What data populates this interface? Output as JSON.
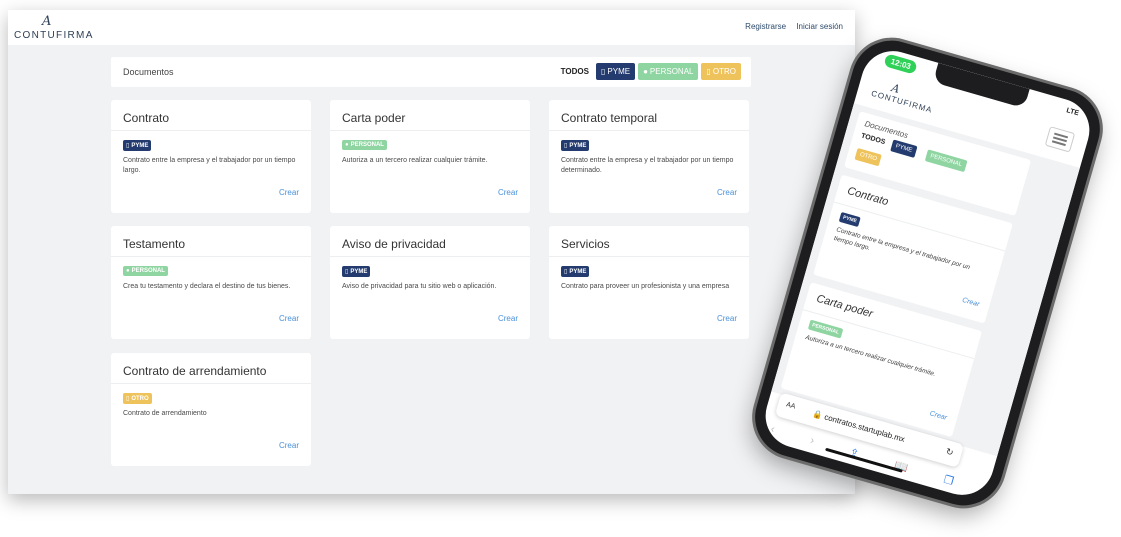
{
  "brand": {
    "mark": "A",
    "name": "CONTUFIRMA"
  },
  "nav": {
    "register": "Registrarse",
    "login": "Iniciar sesión"
  },
  "documents_bar": {
    "title": "Documentos",
    "filters": {
      "all": "TODOS",
      "pyme": "PYME",
      "personal": "PERSONAL",
      "otro": "OTRO"
    }
  },
  "cards": [
    {
      "title": "Contrato",
      "badge": "PYME",
      "description": "Contrato entre la empresa y el trabajador por un tiempo largo.",
      "action": "Crear"
    },
    {
      "title": "Carta poder",
      "badge": "PERSONAL",
      "description": "Autoriza a un tercero realizar cualquier trámite.",
      "action": "Crear"
    },
    {
      "title": "Contrato temporal",
      "badge": "PYME",
      "description": "Contrato entre la empresa y el trabajador por un tiempo determinado.",
      "action": "Crear"
    },
    {
      "title": "Testamento",
      "badge": "PERSONAL",
      "description": "Crea tu testamento y declara el destino de tus bienes.",
      "action": "Crear"
    },
    {
      "title": "Aviso de privacidad",
      "badge": "PYME",
      "description": "Aviso de privacidad para tu sitio web o aplicación.",
      "action": "Crear"
    },
    {
      "title": "Servicios",
      "badge": "PYME",
      "description": "Contrato para proveer un profesionista y una empresa",
      "action": "Crear"
    },
    {
      "title": "Contrato de arrendamiento",
      "badge": "OTRO",
      "description": "Contrato de arrendamiento",
      "action": "Crear"
    }
  ],
  "colors": {
    "pyme": "#233b6e",
    "personal": "#8fd5a1",
    "otro": "#efc35c",
    "link": "#4a90d9"
  },
  "phone": {
    "time": "12:03",
    "status": "LTE",
    "url": "contratos.startuplab.mx",
    "text_size": "AA"
  },
  "icons": {
    "pyme": "building-icon",
    "personal": "person-icon",
    "otro": "document-icon",
    "menu": "hamburger-icon",
    "lock": "lock-icon",
    "reload": "reload-icon",
    "back": "chevron-left-icon",
    "forward": "chevron-right-icon",
    "share": "share-icon",
    "bookmarks": "book-icon",
    "tabs": "tabs-icon"
  }
}
